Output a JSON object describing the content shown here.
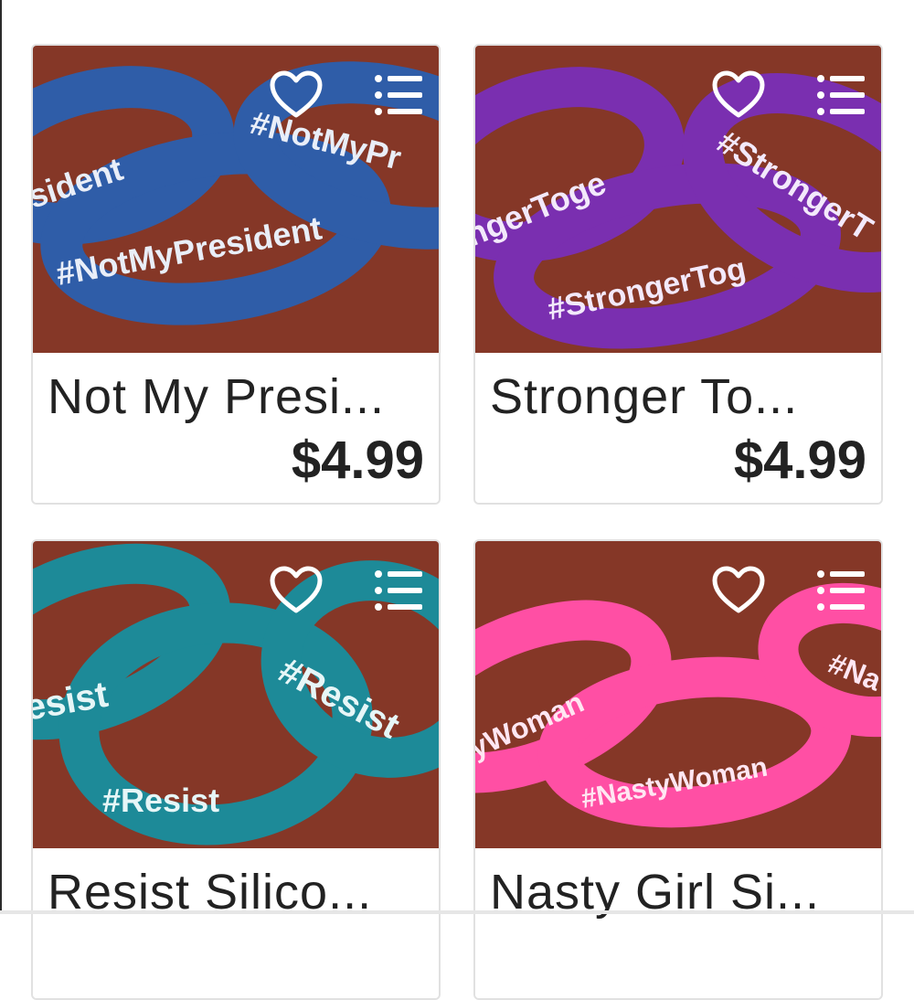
{
  "listings": [
    {
      "title": "Not My Presi...",
      "price": "$4.99",
      "band_color": "#2f5da8",
      "photo_text": [
        "#NotMyPresident",
        "sident",
        "#NotMyPr"
      ]
    },
    {
      "title": "Stronger To...",
      "price": "$4.99",
      "band_color": "#7a2fb0",
      "photo_text": [
        "#StrongerTog",
        "ngerToge",
        "#StrongerT"
      ]
    },
    {
      "title": "Resist Silico...",
      "price": "",
      "band_color": "#1d8a98",
      "photo_text": [
        "#Resist",
        "esist",
        "#Resist"
      ]
    },
    {
      "title": "Nasty Girl Si...",
      "price": "",
      "band_color": "#ff4fa4",
      "photo_text": [
        "#NastyWoman",
        "yWoman",
        "#Na"
      ]
    }
  ],
  "icons": {
    "favorite": "heart-outline-icon",
    "add_to_list": "list-icon"
  },
  "colors": {
    "background_fabric": "#8d3b2a",
    "text": "#222222",
    "card_border": "#e1e1e1"
  }
}
